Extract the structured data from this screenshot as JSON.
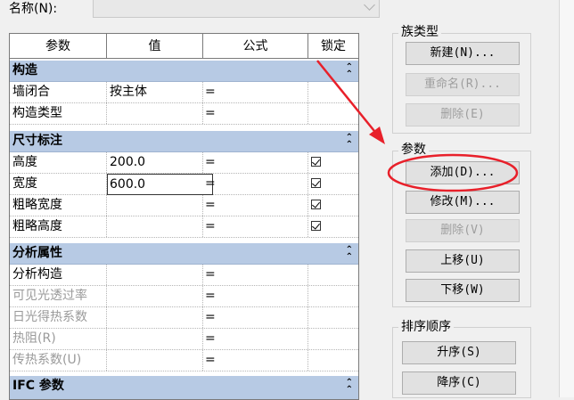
{
  "name_field": {
    "label": "名称(N):",
    "value": ""
  },
  "table": {
    "headers": [
      "参数",
      "值",
      "公式",
      "锁定"
    ],
    "groups": [
      {
        "title": "构造",
        "rows": [
          {
            "param": "墙闭合",
            "value": "按主体",
            "formula": "=",
            "locked": null,
            "disabled": false
          },
          {
            "param": "构造类型",
            "value": "",
            "formula": "=",
            "locked": null,
            "disabled": false
          }
        ]
      },
      {
        "title": "尺寸标注",
        "rows": [
          {
            "param": "高度",
            "value": "200.0",
            "formula": "=",
            "locked": true,
            "disabled": false
          },
          {
            "param": "宽度",
            "value": "600.0",
            "formula": "=",
            "locked": true,
            "disabled": false
          },
          {
            "param": "粗略宽度",
            "value": "",
            "formula": "=",
            "locked": true,
            "disabled": false
          },
          {
            "param": "粗略高度",
            "value": "",
            "formula": "=",
            "locked": true,
            "disabled": false
          }
        ]
      },
      {
        "title": "分析属性",
        "rows": [
          {
            "param": "分析构造",
            "value": "",
            "formula": "=",
            "locked": null,
            "disabled": false
          },
          {
            "param": "可见光透过率",
            "value": "",
            "formula": "=",
            "locked": null,
            "disabled": true
          },
          {
            "param": "日光得热系数",
            "value": "",
            "formula": "=",
            "locked": null,
            "disabled": true
          },
          {
            "param": "热阻(R)",
            "value": "",
            "formula": "=",
            "locked": null,
            "disabled": true
          },
          {
            "param": "传热系数(U)",
            "value": "",
            "formula": "=",
            "locked": null,
            "disabled": true
          }
        ]
      },
      {
        "title": "IFC 参数",
        "rows": []
      }
    ]
  },
  "family_types": {
    "title": "族类型",
    "new_button": "新建(N)...",
    "rename_button": "重命名(R)...",
    "delete_button": "删除(E)"
  },
  "parameters": {
    "title": "参数",
    "add_button": "添加(D)...",
    "modify_button": "修改(M)...",
    "delete_button": "删除(V)",
    "move_up_button": "上移(U)",
    "move_down_button": "下移(W)"
  },
  "sort_order": {
    "title": "排序顺序",
    "ascending_button": "升序(S)",
    "descending_button": "降序(C)"
  },
  "annotation_color": "#e8202a"
}
